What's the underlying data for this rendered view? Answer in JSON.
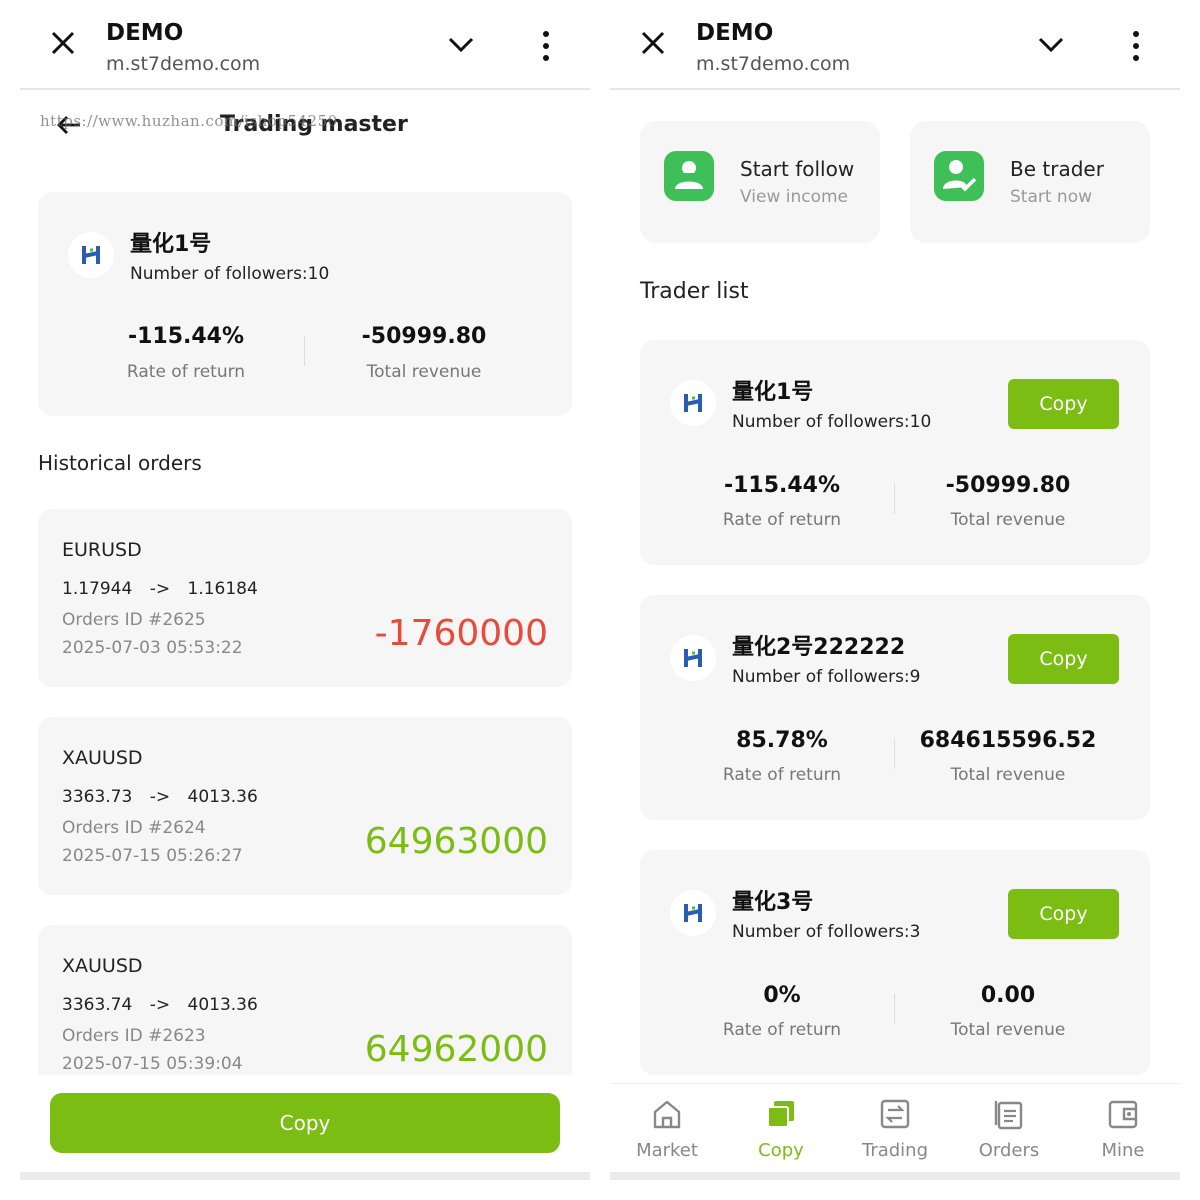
{
  "browser": {
    "title": "DEMO",
    "url": "m.st7demo.com"
  },
  "left": {
    "page_title": "Trading master",
    "watermark": "https://www.huzhan.com/ishop54250",
    "trader": {
      "name": "量化1号",
      "followers": "Number of followers:10",
      "rate": "-115.44%",
      "rate_label": "Rate of return",
      "revenue": "-50999.80",
      "revenue_label": "Total revenue"
    },
    "history_title": "Historical orders",
    "orders": [
      {
        "symbol": "EURUSD",
        "open": "1.17944",
        "arrow": "->",
        "close": "1.16184",
        "id": "Orders ID #2625",
        "time": "2025-07-03 05:53:22",
        "amount": "-1760000",
        "color": "#e84b3c"
      },
      {
        "symbol": "XAUUSD",
        "open": "3363.73",
        "arrow": "->",
        "close": "4013.36",
        "id": "Orders ID #2624",
        "time": "2025-07-15 05:26:27",
        "amount": "64963000",
        "color": "#7cbd13"
      },
      {
        "symbol": "XAUUSD",
        "open": "3363.74",
        "arrow": "->",
        "close": "4013.36",
        "id": "Orders ID #2623",
        "time": "2025-07-15 05:39:04",
        "amount": "64962000",
        "color": "#7cbd13"
      }
    ],
    "copy_button": "Copy"
  },
  "right": {
    "actions": [
      {
        "title": "Start follow",
        "subtitle": "View income",
        "icon": "users-icon"
      },
      {
        "title": "Be trader",
        "subtitle": "Start now",
        "icon": "user-check-icon"
      }
    ],
    "list_title": "Trader list",
    "traders": [
      {
        "name": "量化1号",
        "followers": "Number of followers:10",
        "rate": "-115.44%",
        "rate_label": "Rate of return",
        "revenue": "-50999.80",
        "revenue_label": "Total revenue",
        "copy": "Copy"
      },
      {
        "name": "量化2号222222",
        "followers": "Number of followers:9",
        "rate": "85.78%",
        "rate_label": "Rate of return",
        "revenue": "684615596.52",
        "revenue_label": "Total revenue",
        "copy": "Copy"
      },
      {
        "name": "量化3号",
        "followers": "Number of followers:3",
        "rate": "0%",
        "rate_label": "Rate of return",
        "revenue": "0.00",
        "revenue_label": "Total revenue",
        "copy": "Copy"
      }
    ],
    "tabs": [
      {
        "label": "Market",
        "icon": "home-icon"
      },
      {
        "label": "Copy",
        "icon": "copy-icon",
        "active": true
      },
      {
        "label": "Trading",
        "icon": "exchange-icon"
      },
      {
        "label": "Orders",
        "icon": "orders-icon"
      },
      {
        "label": "Mine",
        "icon": "wallet-icon"
      }
    ]
  },
  "colors": {
    "accent": "#7cbd13",
    "loss": "#e84b3c",
    "card": "#f6f6f6",
    "icon_green": "#3fbf57"
  }
}
